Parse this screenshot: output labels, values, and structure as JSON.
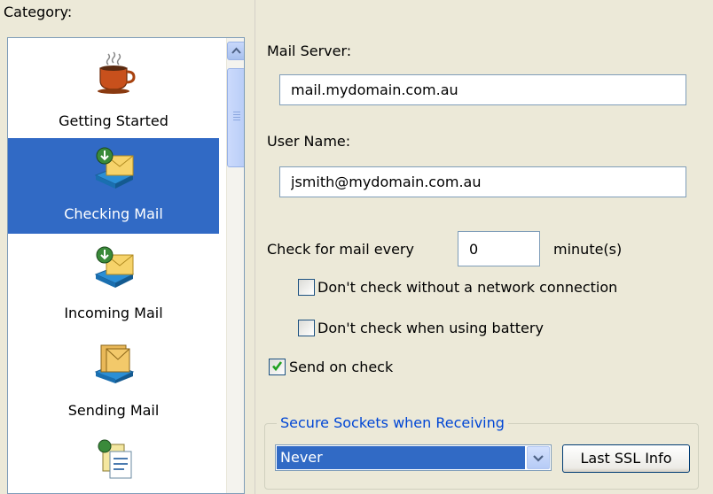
{
  "category": {
    "label": "Category:",
    "items": [
      {
        "label": "Getting Started",
        "icon": "coffee-cup-icon",
        "selected": false
      },
      {
        "label": "Checking Mail",
        "icon": "check-mail-icon",
        "selected": true
      },
      {
        "label": "Incoming Mail",
        "icon": "incoming-mail-icon",
        "selected": false
      },
      {
        "label": "Sending Mail",
        "icon": "sending-mail-icon",
        "selected": false
      },
      {
        "label": "",
        "icon": "composing-icon",
        "selected": false
      }
    ]
  },
  "settings": {
    "mail_server_label": "Mail Server:",
    "mail_server_value": "mail.mydomain.com.au",
    "user_name_label": "User Name:",
    "user_name_value": "jsmith@mydomain.com.au",
    "check_every_label": "Check for mail every",
    "check_every_value": "0",
    "check_every_unit": "minute(s)",
    "no_network_label": "Don't check without a network connection",
    "no_network_checked": false,
    "battery_label": "Don't check when using battery",
    "battery_checked": false,
    "send_on_check_label": "Send on check",
    "send_on_check_checked": true
  },
  "ssl": {
    "group_label": "Secure Sockets when Receiving",
    "selected": "Never",
    "info_button": "Last SSL Info"
  },
  "colors": {
    "selection": "#316ac5",
    "background": "#ece9d8",
    "group_label": "#0046d5"
  }
}
